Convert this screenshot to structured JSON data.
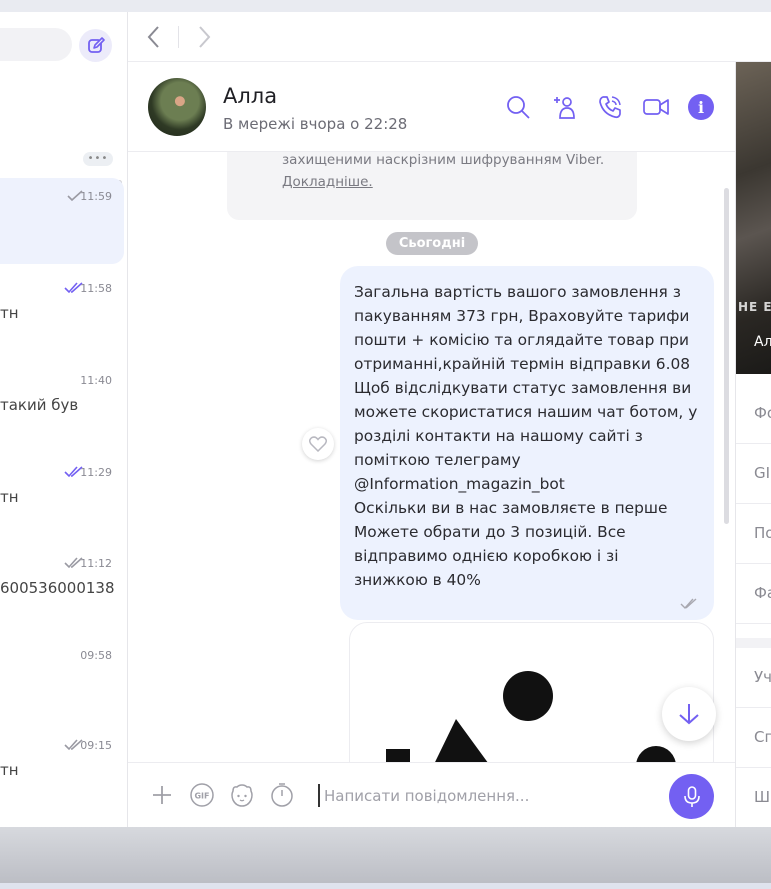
{
  "chat_list": {
    "items": [
      {
        "time": "11:59",
        "status": "sent",
        "preview": "",
        "active": true
      },
      {
        "time": "11:58",
        "status": "seen",
        "preview": "тн",
        "active": false
      },
      {
        "time": "11:40",
        "status": "none",
        "preview": "такий був",
        "active": false
      },
      {
        "time": "11:29",
        "status": "seen",
        "preview": "тн",
        "active": false
      },
      {
        "time": "11:12",
        "status": "delivered",
        "preview": "600536000138",
        "active": false
      },
      {
        "time": "09:58",
        "status": "none",
        "preview": "",
        "active": false
      },
      {
        "time": "09:15",
        "status": "delivered",
        "preview": "тн",
        "active": false
      }
    ],
    "more_label": "•••"
  },
  "conversation": {
    "name": "Алла",
    "status": "В мережі вчора о 22:28"
  },
  "messages": {
    "system_line1": "захищеними наскрізним шифруванням Viber.",
    "system_link": "Докладніше.",
    "date_label": "Сьогодні",
    "bubble_lines": [
      "Загальна вартість вашого замовлення з",
      "пакуванням 373 грн, Враховуйте тарифи",
      "пошти + комісію  та оглядайте товар при",
      "отриманні,крайній термін відправки 6.08",
      "Щоб відслідкувати статус замовлення ви",
      "можете скористатися нашим чат ботом, у",
      "розділі контакти на нашому сайті з",
      "поміткою телеграму",
      "@Information_magazin_bot",
      "Оскільки ви в нас замовляєте в перше",
      "Можете обрати до 3 позицій. Все",
      "відправимо однією коробкою і зі",
      "знижкою в 40%"
    ]
  },
  "composer": {
    "placeholder": "Написати повідомлення..."
  },
  "right_panel": {
    "photo_caption": "Ал",
    "photo_text": "НЕ Е СОБІ",
    "rows": [
      "Фо",
      "GI",
      "По",
      "Фа",
      "Уч",
      "Сп",
      "Ш"
    ]
  },
  "colors": {
    "accent": "#7360f2",
    "bubble": "#edf2fe",
    "active_item": "#eef2fd"
  }
}
